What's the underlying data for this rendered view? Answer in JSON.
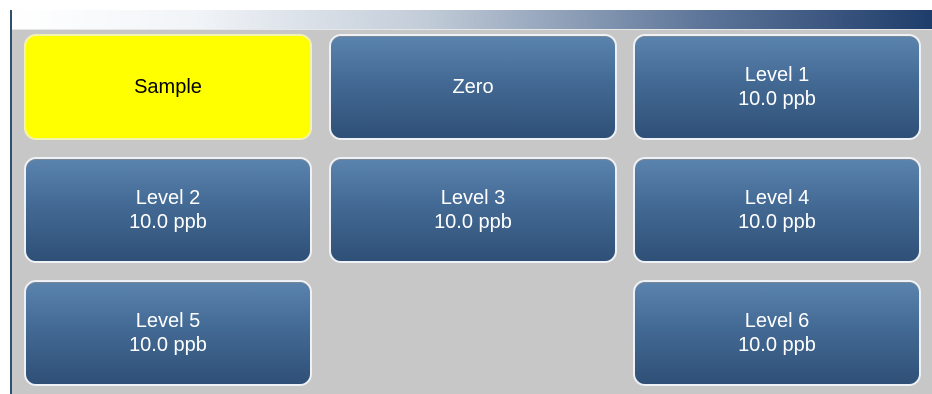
{
  "screen": {
    "buttons": [
      {
        "label": "Sample",
        "value": "",
        "selected": true
      },
      {
        "label": "Zero",
        "value": ""
      },
      {
        "label": "Level 1",
        "value": "10.0 ppb"
      },
      {
        "label": "Level 2",
        "value": "10.0 ppb"
      },
      {
        "label": "Level 3",
        "value": "10.0 ppb"
      },
      {
        "label": "Level 4",
        "value": "10.0 ppb"
      },
      {
        "label": "Level 5",
        "value": "10.0 ppb"
      },
      {
        "label": "Level 6",
        "value": "10.0 ppb"
      }
    ]
  },
  "colors": {
    "selected_button": "#ffff00",
    "button_blue_top": "#5a83ad",
    "button_blue_bottom": "#2f5077",
    "background": "#c7c7c7"
  }
}
